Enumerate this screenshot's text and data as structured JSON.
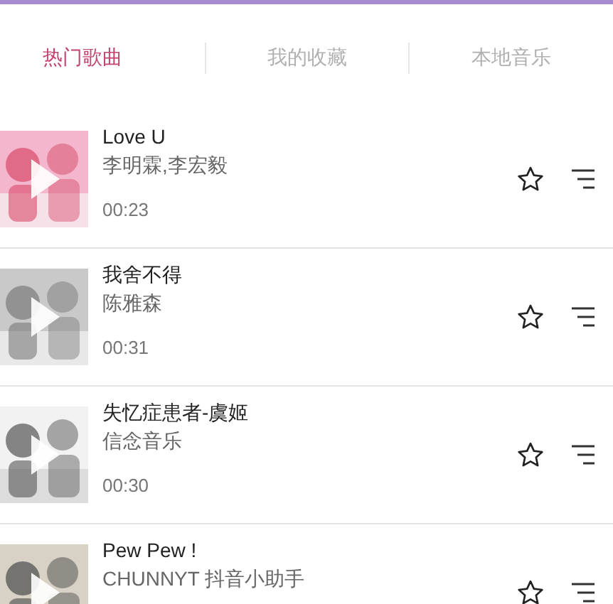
{
  "tabs": [
    {
      "label": "热门歌曲",
      "selected": true
    },
    {
      "label": "我的收藏",
      "selected": false
    },
    {
      "label": "本地音乐",
      "selected": false
    }
  ],
  "songs": [
    {
      "title": "Love U",
      "artist": "李明霖,李宏毅",
      "duration": "00:23"
    },
    {
      "title": "我舍不得",
      "artist": "陈雅森",
      "duration": "00:31"
    },
    {
      "title": "失忆症患者-虞姬",
      "artist": "信念音乐",
      "duration": "00:30"
    },
    {
      "title": "Pew Pew !",
      "artist": "CHUNNYT 抖音小助手"
    }
  ]
}
